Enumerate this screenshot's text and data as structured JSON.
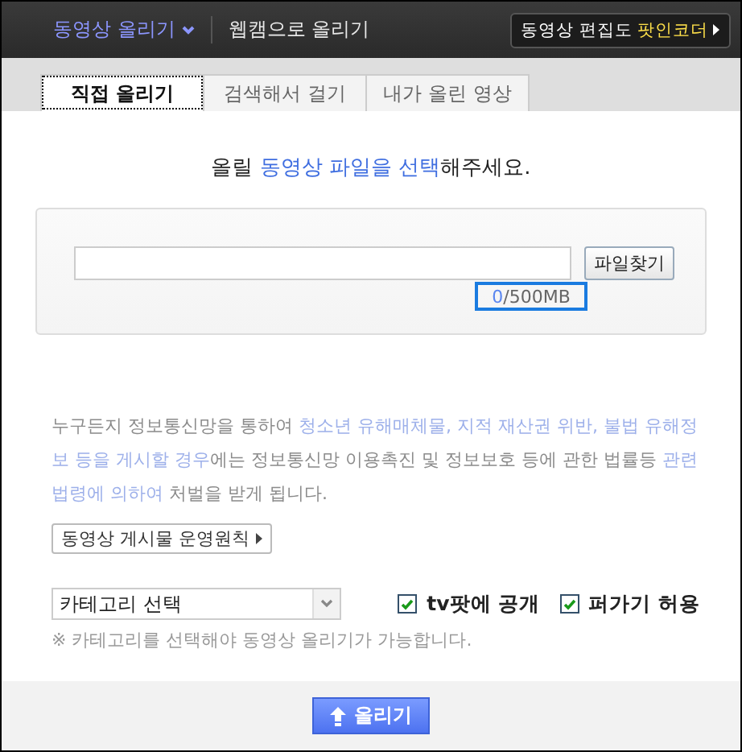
{
  "header": {
    "menu": [
      {
        "label": "동영상 올리기",
        "selected": true
      },
      {
        "label": "웹캠으로 올리기",
        "selected": false
      }
    ],
    "promo": {
      "text": "동영상 편집도 ",
      "highlight": "팟인코더"
    }
  },
  "tabs": [
    {
      "label": "직접 올리기",
      "selected": true
    },
    {
      "label": "검색해서 걸기",
      "selected": false
    },
    {
      "label": "내가 올린 영상",
      "selected": false
    }
  ],
  "instruction": [
    {
      "text": "올릴 ",
      "highlight": false
    },
    {
      "text": "동영상 파일을 선택",
      "highlight": true
    },
    {
      "text": "해주세요.",
      "highlight": false
    }
  ],
  "upload": {
    "browse_button": "파일찾기",
    "size_used": "0",
    "size_limit": " /500MB"
  },
  "notice": [
    {
      "text": "누구든지 정보통신망을 통하여 ",
      "highlight": false
    },
    {
      "text": "청소년 유해매체물, 지적 재산권 위반, 불법 유해정보 등을 게시할 경우",
      "highlight": true
    },
    {
      "text": "에는 정보통신망 이용촉진 및 정보보호 등에 관한 법률등 ",
      "highlight": false
    },
    {
      "text": "관련 법령에 의하여",
      "highlight": true
    },
    {
      "text": " 처벌을 받게 됩니다.",
      "highlight": false
    }
  ],
  "policy_button": "동영상 게시물 운영원칙",
  "category": {
    "value": "카테고리 선택"
  },
  "options": [
    {
      "label": "tv팟에 공개",
      "checked": true
    },
    {
      "label": "퍼가기 허용",
      "checked": true
    }
  ],
  "category_note": "※ 카테고리를 선택해야 동영상 올리기가 가능합니다.",
  "submit_button": "올리기"
}
